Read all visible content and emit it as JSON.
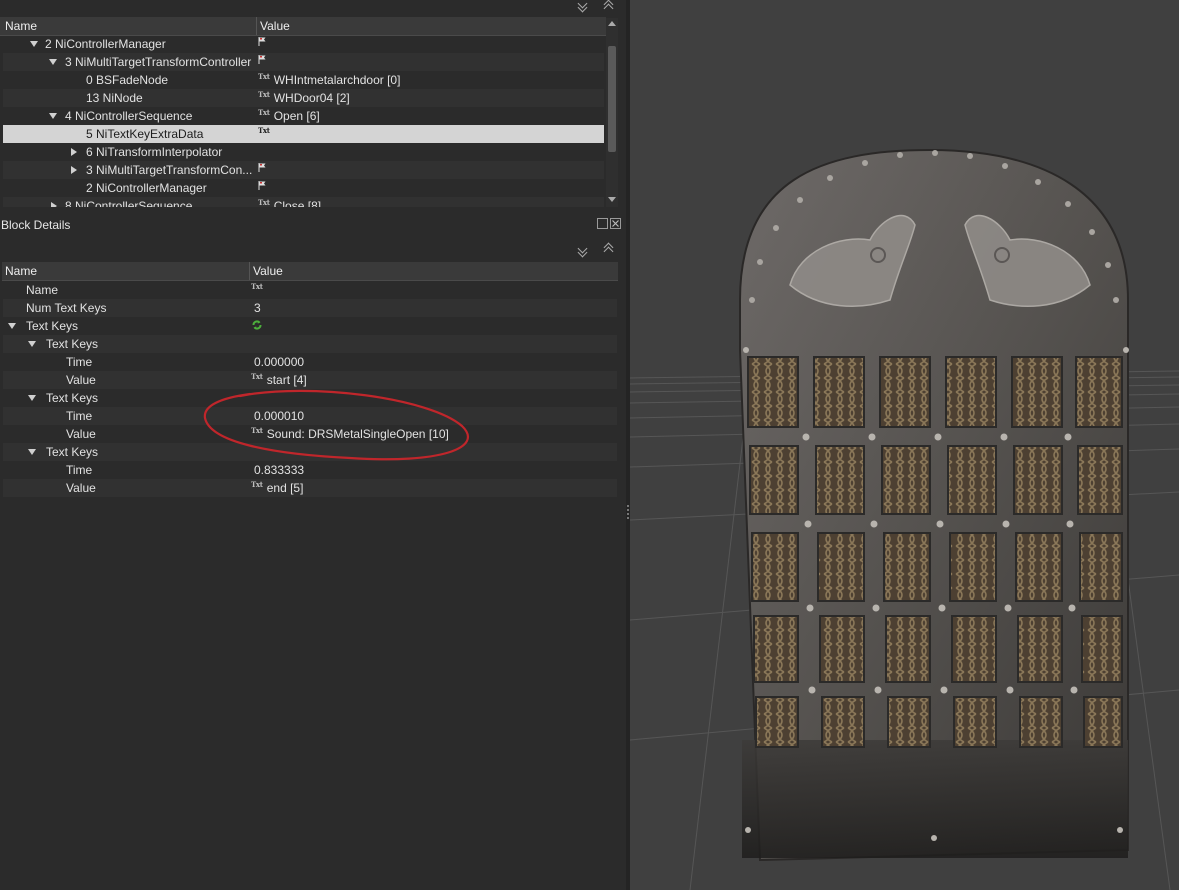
{
  "block_list": {
    "columns": {
      "name": "Name",
      "value": "Value"
    },
    "rows": [
      {
        "name": "2 NiControllerManager",
        "value": ""
      },
      {
        "name": "3 NiMultiTargetTransformController",
        "value": ""
      },
      {
        "name": "0 BSFadeNode",
        "value": "WHIntmetalarchdoor [0]"
      },
      {
        "name": "13 NiNode",
        "value": "WHDoor04 [2]"
      },
      {
        "name": "4 NiControllerSequence",
        "value": "Open [6]"
      },
      {
        "name": "5 NiTextKeyExtraData",
        "value": ""
      },
      {
        "name": "6 NiTransformInterpolator",
        "value": ""
      },
      {
        "name": "3 NiMultiTargetTransformCon...",
        "value": ""
      },
      {
        "name": "2 NiControllerManager",
        "value": ""
      },
      {
        "name": "8 NiControllerSequence",
        "value": "Close [8]"
      }
    ],
    "selected_row": "5 NiTextKeyExtraData"
  },
  "block_details": {
    "title": "Block Details",
    "columns": {
      "name": "Name",
      "value": "Value"
    },
    "rows": [
      {
        "name": "Name",
        "value": ""
      },
      {
        "name": "Num Text Keys",
        "value": "3"
      },
      {
        "name": "Text Keys",
        "value": ""
      },
      {
        "name": "Text Keys",
        "value": ""
      },
      {
        "name": "Time",
        "value": "0.000000"
      },
      {
        "name": "Value",
        "value": "start [4]"
      },
      {
        "name": "Text Keys",
        "value": ""
      },
      {
        "name": "Time",
        "value": "0.000010"
      },
      {
        "name": "Value",
        "value": "Sound: DRSMetalSingleOpen [10]"
      },
      {
        "name": "Text Keys",
        "value": ""
      },
      {
        "name": "Time",
        "value": "0.833333"
      },
      {
        "name": "Value",
        "value": "end [5]"
      }
    ]
  },
  "icons": {
    "txt": "Txt",
    "flag": "flag-icon",
    "refresh": "refresh-icon"
  },
  "annotation": {
    "shape": "red hand-drawn ellipse",
    "color": "#c0262b"
  },
  "viewport": {
    "object": "arched iron door with knotwork panels and bear head reliefs"
  },
  "colors": {
    "selection": "#d4d4d4",
    "background": "#2b2b2b",
    "viewport": "#404040"
  }
}
